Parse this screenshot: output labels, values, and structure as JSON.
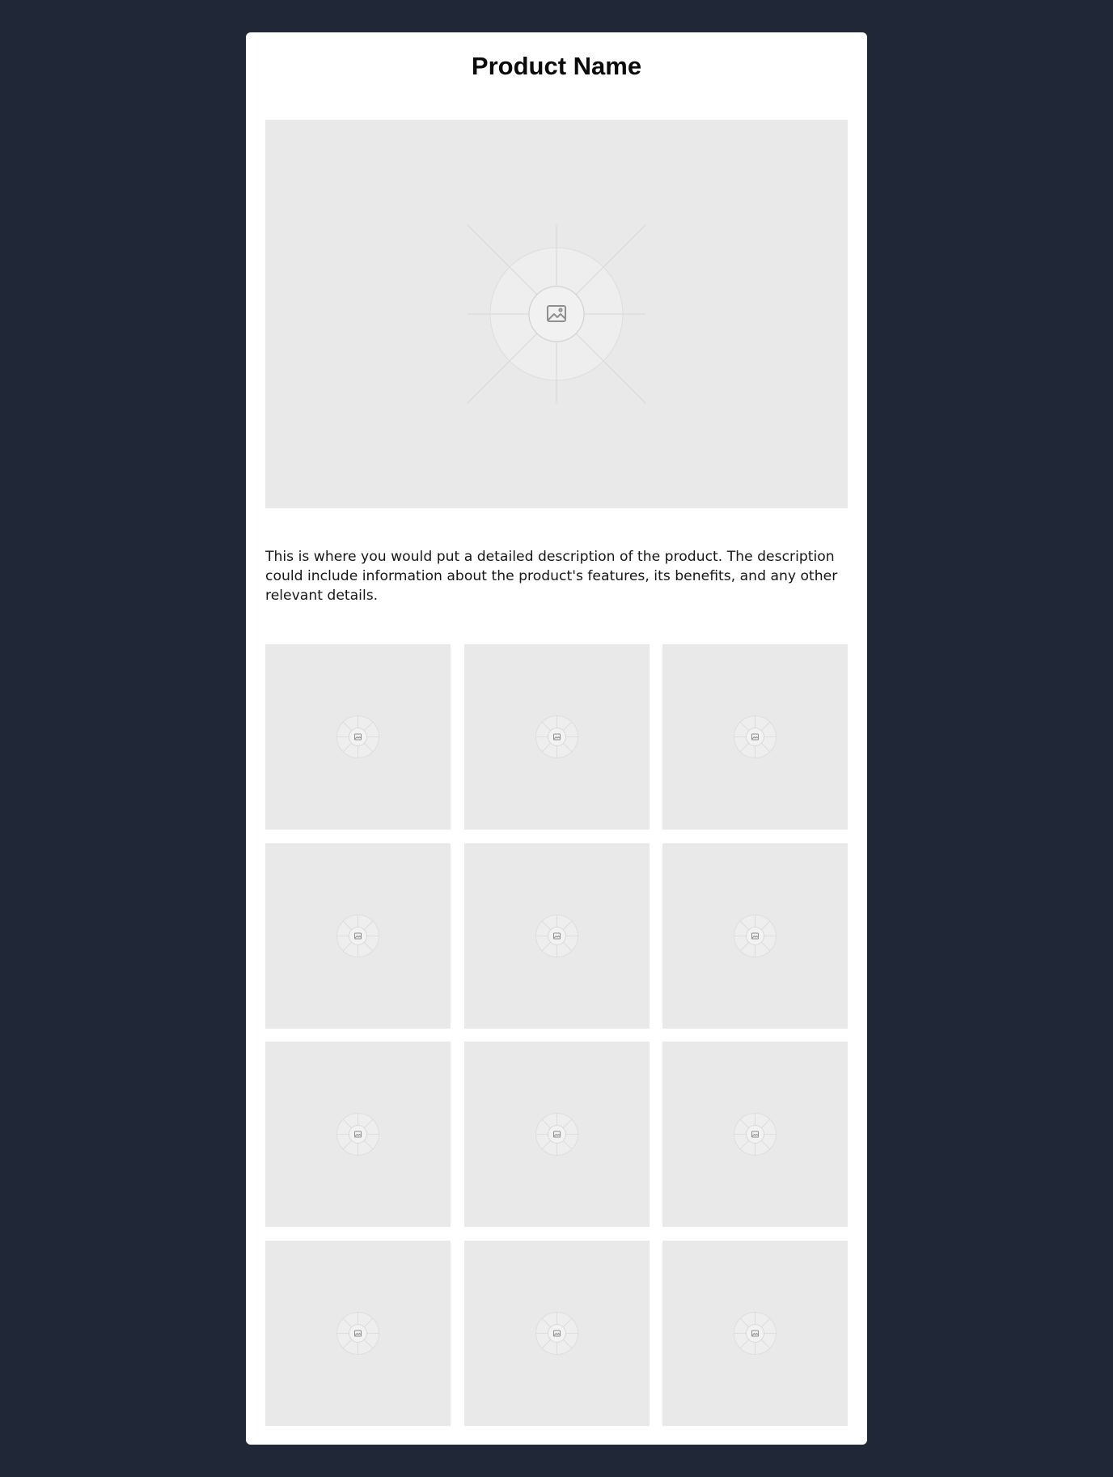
{
  "product": {
    "name": "Product Name",
    "description": "This is where you would put a detailed description of the product. The description could include information about the product's features, its benefits, and any other relevant details."
  },
  "main_image": {
    "icon": "image-placeholder-icon"
  },
  "gallery": {
    "count": 12,
    "icon": "image-placeholder-icon"
  },
  "colors": {
    "page_background": "#202837",
    "card_background": "#ffffff",
    "placeholder_background": "#e9e9e9",
    "placeholder_icon": "#9a9a9a"
  }
}
